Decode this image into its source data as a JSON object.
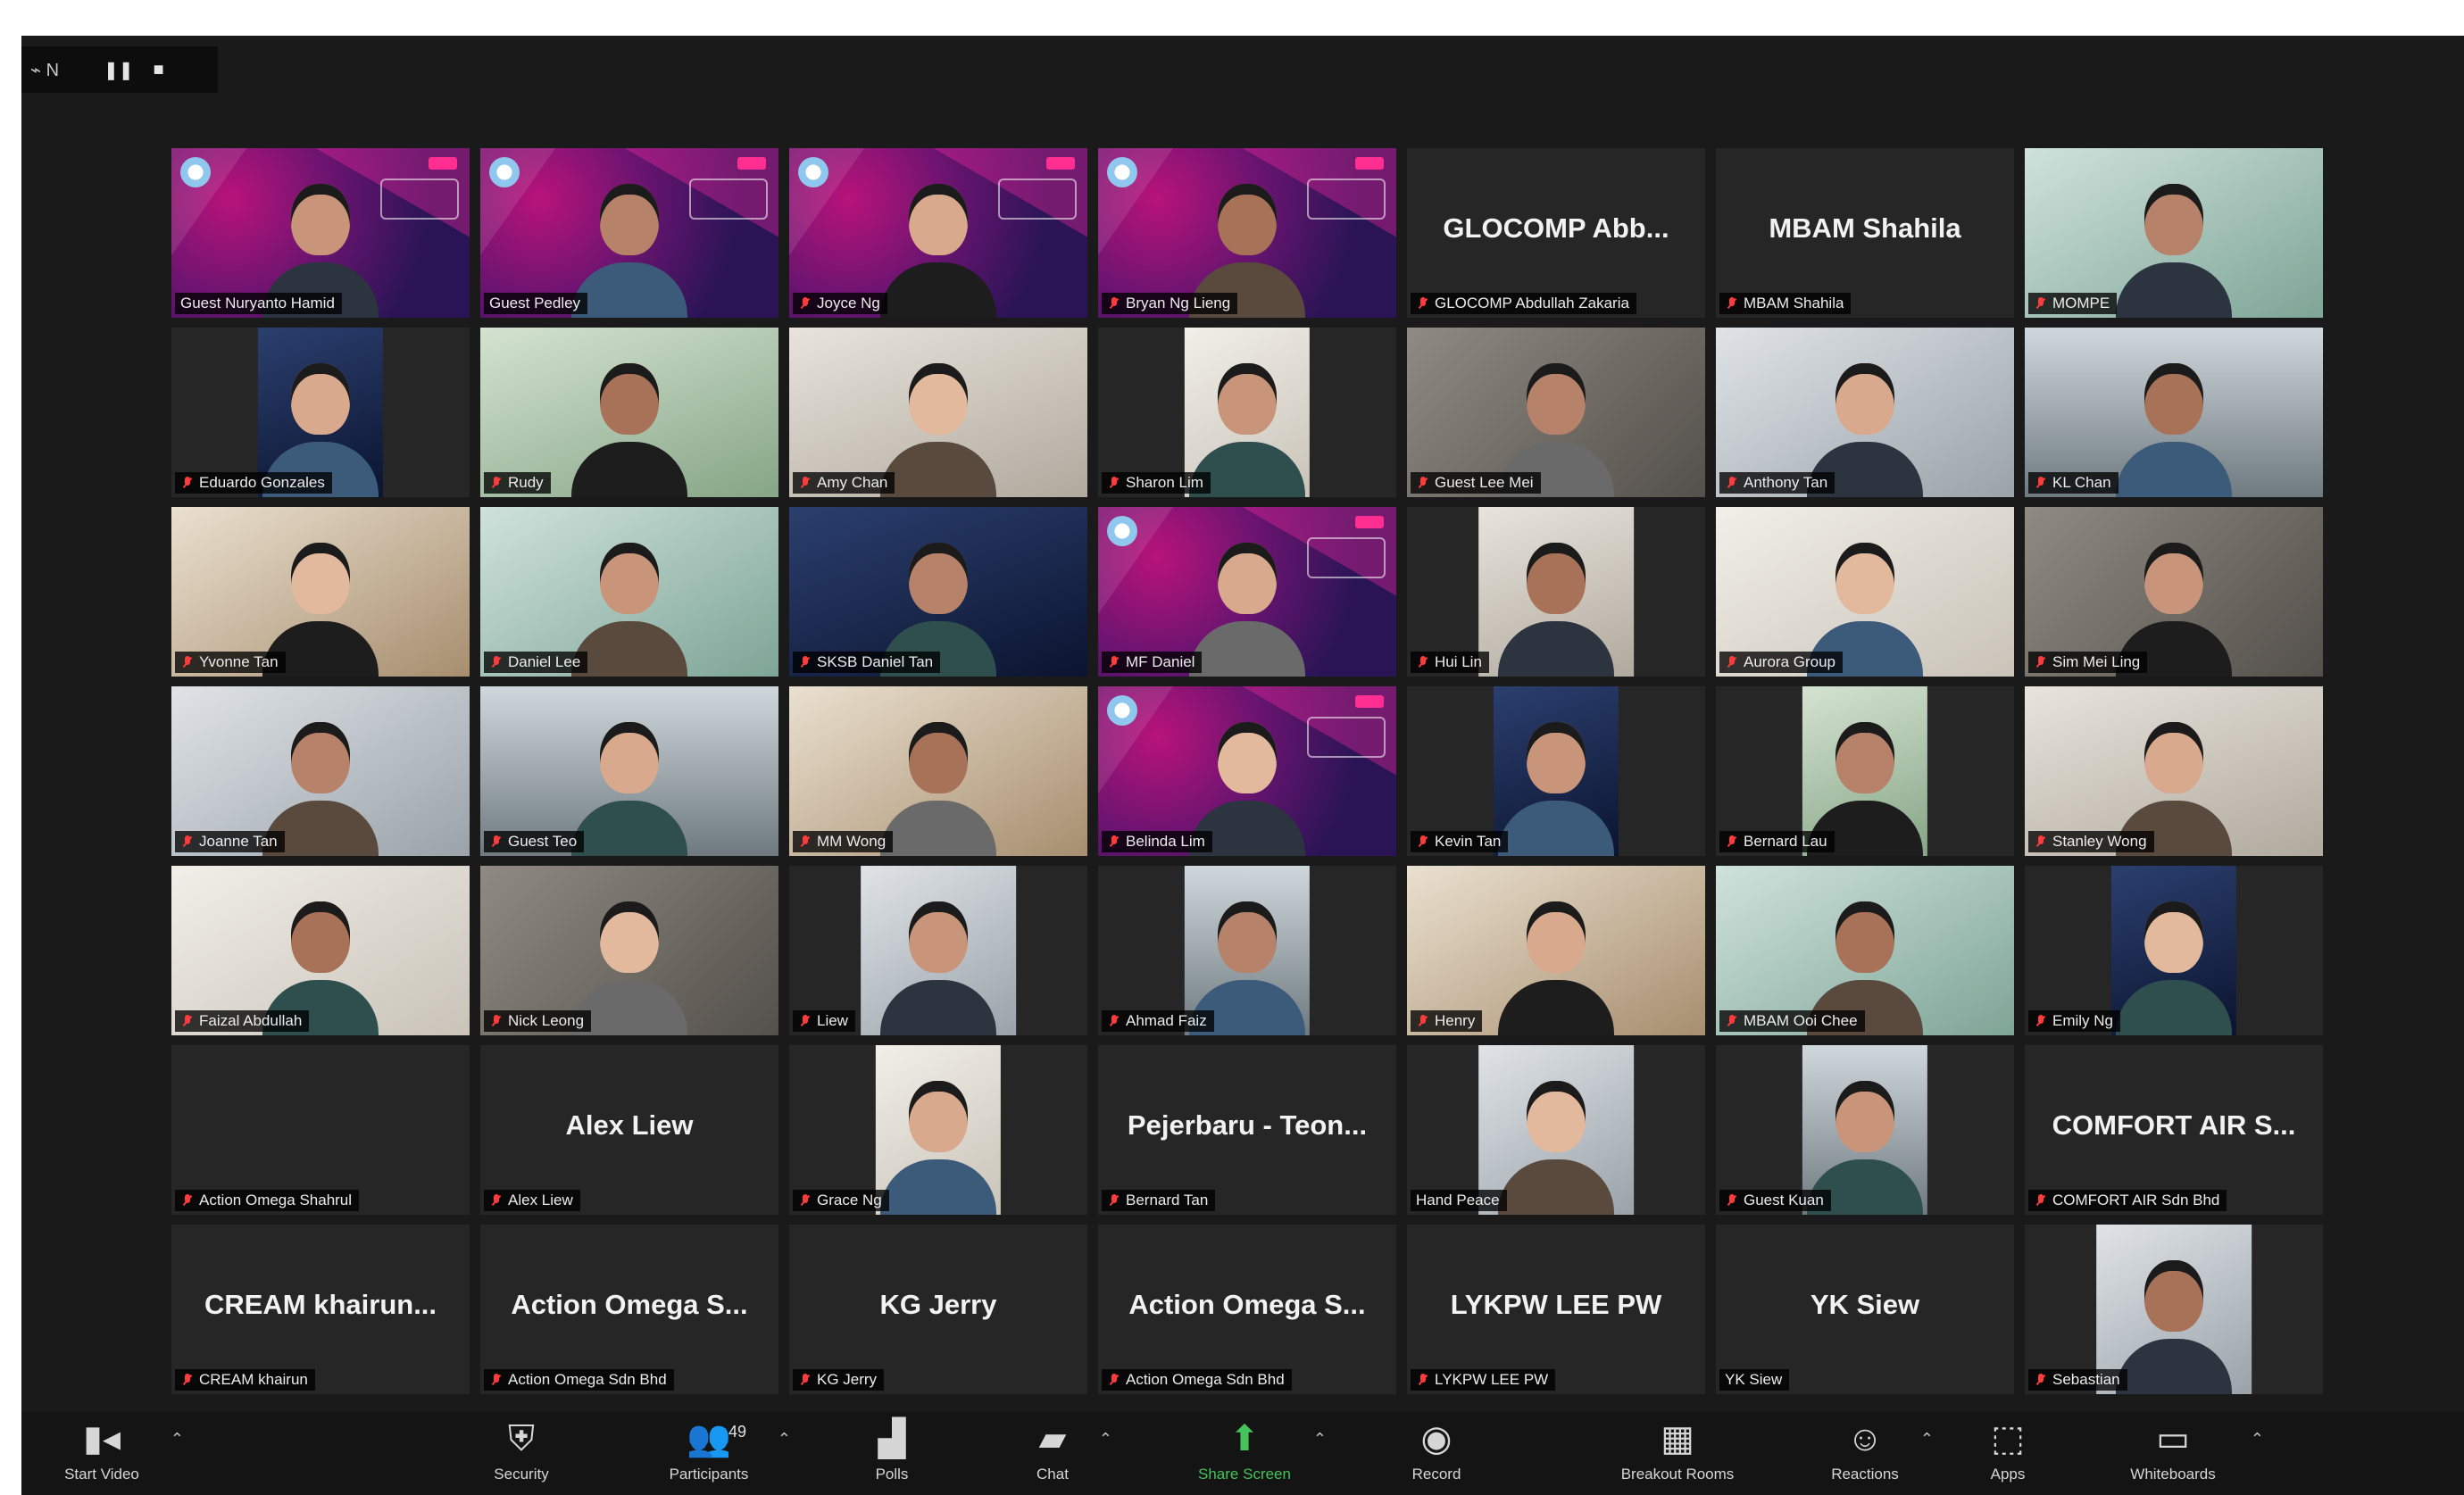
{
  "meeting": {
    "status": "⌁ N",
    "window_icons": [
      "pause-icon",
      "stop-icon"
    ]
  },
  "colors": {
    "window_bg": "#1a1a1a",
    "active_speaker_border": "#f2e74a",
    "muted_icon": "#ff3b3b",
    "share_green": "#46c35a"
  },
  "participants": [
    {
      "name": "Guest Nuryanto Hamid",
      "type": "video",
      "branded": true,
      "muted": false
    },
    {
      "name": "Guest Pedley",
      "type": "video",
      "branded": true,
      "muted": false,
      "active": true
    },
    {
      "name": "Joyce Ng",
      "type": "video",
      "branded": true,
      "muted": true
    },
    {
      "name": "Bryan Ng Lieng",
      "type": "video",
      "branded": true,
      "muted": true
    },
    {
      "name": "GLOCOMP Abdullah Zakaria",
      "display": "GLOCOMP Abb...",
      "type": "text",
      "muted": true
    },
    {
      "name": "MBAM Shahila",
      "display": "MBAM Shahila",
      "type": "text",
      "muted": true
    },
    {
      "name": "MOMPE",
      "type": "video",
      "muted": true
    },
    {
      "name": "Eduardo Gonzales",
      "type": "video",
      "portrait": true,
      "muted": true
    },
    {
      "name": "Rudy",
      "type": "video",
      "muted": true
    },
    {
      "name": "Amy Chan",
      "type": "video",
      "muted": true
    },
    {
      "name": "Sharon Lim",
      "type": "video",
      "portrait": true,
      "muted": true
    },
    {
      "name": "Guest Lee Mei",
      "type": "video",
      "muted": true
    },
    {
      "name": "Anthony Tan",
      "type": "video",
      "muted": true
    },
    {
      "name": "KL Chan",
      "type": "video",
      "muted": true
    },
    {
      "name": "Yvonne Tan",
      "type": "video",
      "muted": true
    },
    {
      "name": "Daniel Lee",
      "type": "video",
      "muted": true
    },
    {
      "name": "SKSB Daniel Tan",
      "type": "video",
      "muted": true
    },
    {
      "name": "MF Daniel",
      "type": "video",
      "branded": true,
      "muted": true
    },
    {
      "name": "Hui Lin",
      "type": "video",
      "portrait": true,
      "muted": true
    },
    {
      "name": "Aurora Group",
      "type": "video",
      "muted": true
    },
    {
      "name": "Sim Mei Ling",
      "type": "video",
      "muted": true
    },
    {
      "name": "Joanne Tan",
      "type": "video",
      "muted": true
    },
    {
      "name": "Guest Teo",
      "type": "video",
      "muted": true
    },
    {
      "name": "MM Wong",
      "type": "video",
      "muted": true
    },
    {
      "name": "Belinda Lim",
      "type": "video",
      "branded": true,
      "muted": true
    },
    {
      "name": "Kevin Tan",
      "type": "video",
      "portrait": true,
      "muted": true
    },
    {
      "name": "Bernard Lau",
      "type": "video",
      "portrait": true,
      "muted": true
    },
    {
      "name": "Stanley Wong",
      "type": "video",
      "muted": true
    },
    {
      "name": "Faizal Abdullah",
      "type": "video",
      "muted": true
    },
    {
      "name": "Nick Leong",
      "type": "video",
      "muted": true
    },
    {
      "name": "Liew",
      "type": "video",
      "portrait": true,
      "muted": true
    },
    {
      "name": "Ahmad Faiz",
      "type": "video",
      "portrait": true,
      "muted": true
    },
    {
      "name": "Henry",
      "type": "video",
      "muted": true
    },
    {
      "name": "MBAM Ooi Chee",
      "type": "video",
      "muted": true
    },
    {
      "name": "Emily Ng",
      "type": "video",
      "portrait": true,
      "muted": true
    },
    {
      "name": "Action Omega Shahrul",
      "display": "",
      "type": "text",
      "muted": true
    },
    {
      "name": "Alex Liew",
      "display": "Alex Liew",
      "type": "text",
      "muted": true
    },
    {
      "name": "Grace Ng",
      "type": "video",
      "portrait": true,
      "muted": true
    },
    {
      "name": "Bernard Tan",
      "display": "Pejerbaru - Teon...",
      "type": "text",
      "muted": true
    },
    {
      "name": "Hand Peace",
      "type": "video",
      "portrait": true,
      "muted": false
    },
    {
      "name": "Guest Kuan",
      "type": "video",
      "portrait": true,
      "muted": true
    },
    {
      "name": "COMFORT AIR Sdn Bhd",
      "display": "COMFORT AIR S...",
      "type": "text",
      "muted": true
    },
    {
      "name": "CREAM khairun",
      "display": "CREAM khairun...",
      "type": "text",
      "muted": true
    },
    {
      "name": "Action Omega Sdn Bhd",
      "display": "Action Omega S...",
      "type": "text",
      "muted": true
    },
    {
      "name": "KG Jerry",
      "display": "KG Jerry",
      "type": "text",
      "muted": true
    },
    {
      "name": "Action Omega Sdn Bhd",
      "display": "Action Omega S...",
      "type": "text",
      "muted": true
    },
    {
      "name": "LYKPW LEE PW",
      "display": "LYKPW LEE PW",
      "type": "text",
      "muted": true
    },
    {
      "name": "YK Siew",
      "display": "YK Siew",
      "type": "text",
      "muted": false
    },
    {
      "name": "Sebastian",
      "type": "video",
      "portrait": true,
      "muted": true
    }
  ],
  "toolbar": [
    {
      "label": "Start Video",
      "icon": "video-camera-icon",
      "caret": true
    },
    {
      "label": "Security",
      "icon": "shield-icon",
      "caret": false
    },
    {
      "label": "Participants",
      "icon": "participants-icon",
      "count": "49",
      "caret": true
    },
    {
      "label": "Polls",
      "icon": "bar-chart-icon",
      "caret": false
    },
    {
      "label": "Chat",
      "icon": "chat-icon",
      "caret": true
    },
    {
      "label": "Share Screen",
      "icon": "share-screen-icon",
      "caret": true,
      "green": true
    },
    {
      "label": "Record",
      "icon": "record-icon",
      "caret": false
    },
    {
      "label": "Breakout Rooms",
      "icon": "breakout-rooms-icon",
      "caret": false
    },
    {
      "label": "Reactions",
      "icon": "reactions-icon",
      "caret": true
    },
    {
      "label": "Apps",
      "icon": "apps-icon",
      "caret": false
    },
    {
      "label": "Whiteboards",
      "icon": "whiteboard-icon",
      "caret": true
    }
  ]
}
